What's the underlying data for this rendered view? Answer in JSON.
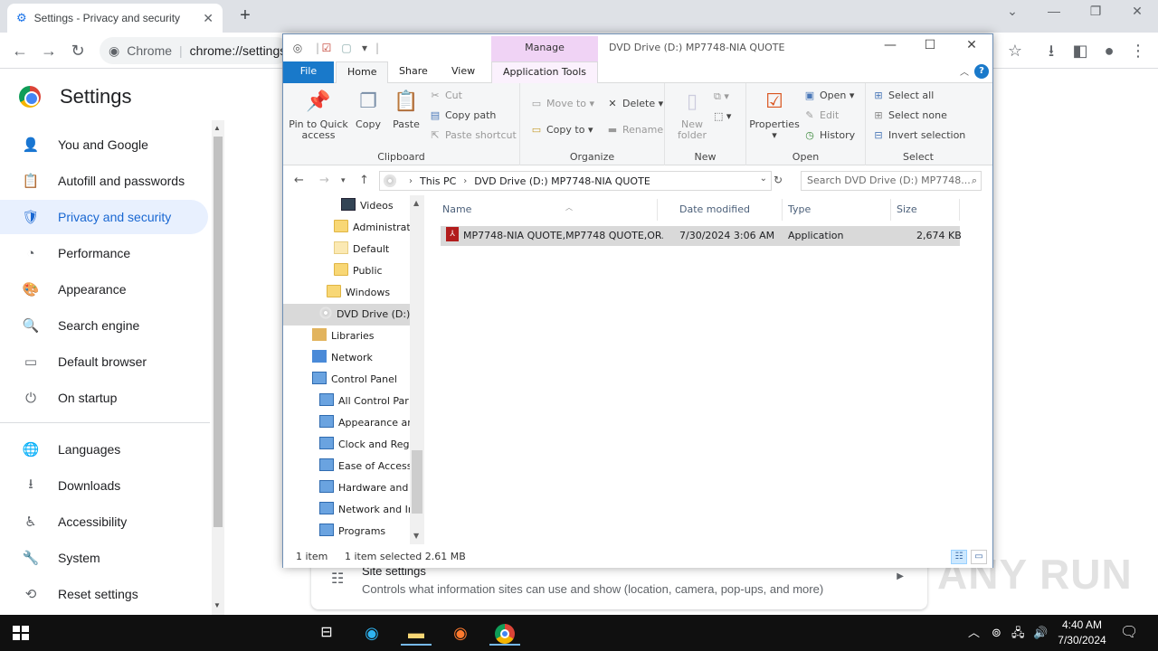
{
  "chrome": {
    "tab_title": "Settings - Privacy and security",
    "tab_close": "✕",
    "new_tab": "+",
    "omnibox_label": "Chrome",
    "omnibox_url": "chrome://settings",
    "settings_title": "Settings",
    "nav": [
      {
        "label": "You and Google",
        "icon": "person-icon",
        "glyph": "👤"
      },
      {
        "label": "Autofill and passwords",
        "icon": "clipboard-icon",
        "glyph": "📋"
      },
      {
        "label": "Privacy and security",
        "icon": "shield-icon",
        "glyph": "🛡",
        "active": true
      },
      {
        "label": "Performance",
        "icon": "speedometer-icon",
        "glyph": "◔"
      },
      {
        "label": "Appearance",
        "icon": "palette-icon",
        "glyph": "🎨"
      },
      {
        "label": "Search engine",
        "icon": "search-icon",
        "glyph": "🔍"
      },
      {
        "label": "Default browser",
        "icon": "browser-icon",
        "glyph": "▭"
      },
      {
        "label": "On startup",
        "icon": "power-icon",
        "glyph": "⏻"
      },
      {
        "label": "Languages",
        "icon": "globe-icon",
        "glyph": "🌐"
      },
      {
        "label": "Downloads",
        "icon": "download-icon",
        "glyph": "⭳"
      },
      {
        "label": "Accessibility",
        "icon": "accessibility-icon",
        "glyph": "♿"
      },
      {
        "label": "System",
        "icon": "wrench-icon",
        "glyph": "🔧"
      },
      {
        "label": "Reset settings",
        "icon": "reset-icon",
        "glyph": "⟲"
      }
    ],
    "site_settings": {
      "title": "Site settings",
      "description": "Controls what information sites can use and show (location, camera, pop-ups, and more)"
    }
  },
  "explorer": {
    "title": "DVD Drive (D:) MP7748-NIA QUOTE",
    "context_tab_header": "Manage",
    "tabs": [
      "File",
      "Home",
      "Share",
      "View",
      "Application Tools"
    ],
    "help": "?",
    "ribbon": {
      "clipboard": {
        "label": "Clipboard",
        "pin": "Pin to Quick access",
        "copy": "Copy",
        "paste": "Paste",
        "cut": "Cut",
        "copy_path": "Copy path",
        "paste_shortcut": "Paste shortcut"
      },
      "organize": {
        "label": "Organize",
        "move_to": "Move to",
        "copy_to": "Copy to",
        "delete": "Delete",
        "rename": "Rename"
      },
      "new": {
        "label": "New",
        "new_folder": "New folder"
      },
      "open": {
        "label": "Open",
        "properties": "Properties",
        "open": "Open",
        "edit": "Edit",
        "history": "History"
      },
      "select": {
        "label": "Select",
        "select_all": "Select all",
        "select_none": "Select none",
        "invert": "Invert selection"
      }
    },
    "address": {
      "crumb1": "This PC",
      "crumb2": "DVD Drive (D:) MP7748-NIA QUOTE"
    },
    "search_placeholder": "Search DVD Drive (D:) MP7748...",
    "tree": [
      {
        "label": "Videos",
        "indent": 64,
        "icon": "video"
      },
      {
        "label": "Administrat",
        "indent": 56,
        "icon": "folder"
      },
      {
        "label": "Default",
        "indent": 56,
        "icon": "folder-light"
      },
      {
        "label": "Public",
        "indent": 56,
        "icon": "folder"
      },
      {
        "label": "Windows",
        "indent": 48,
        "icon": "folder"
      },
      {
        "label": "DVD Drive (D:)",
        "indent": 40,
        "icon": "dvd",
        "selected": true
      },
      {
        "label": "Libraries",
        "indent": 32,
        "icon": "lib"
      },
      {
        "label": "Network",
        "indent": 32,
        "icon": "net"
      },
      {
        "label": "Control Panel",
        "indent": 32,
        "icon": "cp"
      },
      {
        "label": "All Control Par",
        "indent": 40,
        "icon": "cp"
      },
      {
        "label": "Appearance an",
        "indent": 40,
        "icon": "cp"
      },
      {
        "label": "Clock and Regi",
        "indent": 40,
        "icon": "cp"
      },
      {
        "label": "Ease of Access",
        "indent": 40,
        "icon": "cp"
      },
      {
        "label": "Hardware and",
        "indent": 40,
        "icon": "cp"
      },
      {
        "label": "Network and Ir",
        "indent": 40,
        "icon": "cp"
      },
      {
        "label": "Programs",
        "indent": 40,
        "icon": "cp"
      }
    ],
    "columns": [
      "Name",
      "Date modified",
      "Type",
      "Size"
    ],
    "files": [
      {
        "name": "MP7748-NIA QUOTE,MP7748 QUOTE,OR...",
        "date": "7/30/2024 3:06 AM",
        "type": "Application",
        "size": "2,674 KB"
      }
    ],
    "status": {
      "count": "1 item",
      "selected": "1 item selected  2.61 MB"
    }
  },
  "taskbar": {
    "time": "4:40 AM",
    "date": "7/30/2024"
  },
  "watermark": "ANY RUN"
}
